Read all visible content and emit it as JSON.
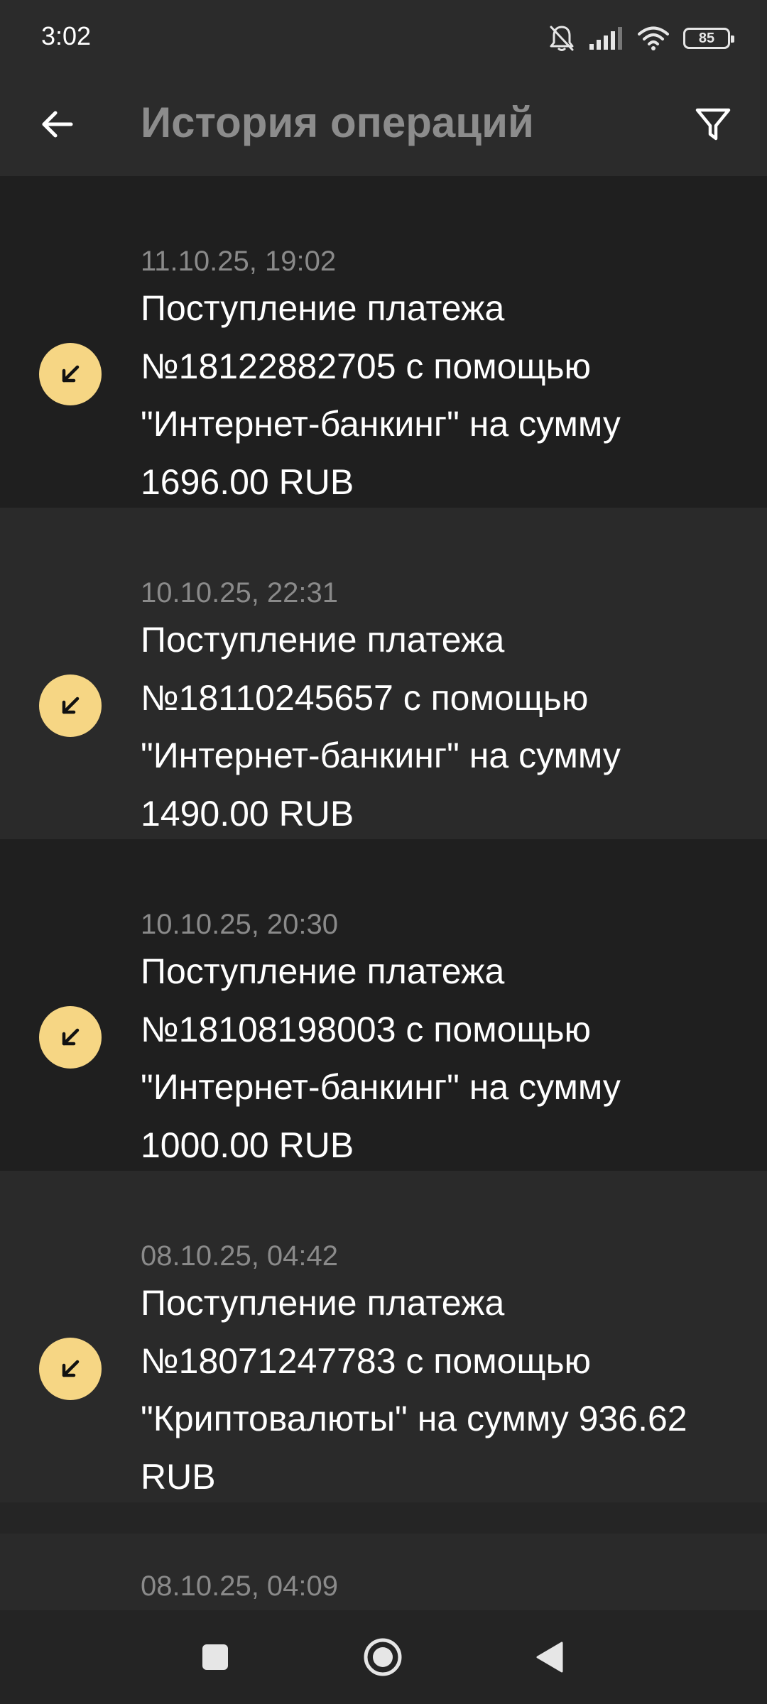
{
  "status_bar": {
    "time": "3:02",
    "battery": "85",
    "icons": [
      "bell-off-icon",
      "signal-icon",
      "wifi-icon",
      "battery-icon"
    ]
  },
  "header": {
    "title": "История операций",
    "back_icon": "arrow-left-icon",
    "filter_icon": "filter-icon"
  },
  "operations": [
    {
      "date": "11.10.25, 19:02",
      "description": "Поступление платежа №18122882705 с помощью \"Интернет-банкинг\" на сумму 1696.00 RUB",
      "icon": "incoming-arrow-icon"
    },
    {
      "date": "10.10.25, 22:31",
      "description": "Поступление платежа №18110245657 с помощью \"Интернет-банкинг\" на сумму 1490.00 RUB",
      "icon": "incoming-arrow-icon"
    },
    {
      "date": "10.10.25, 20:30",
      "description": "Поступление платежа №18108198003 с помощью \"Интернет-банкинг\" на сумму 1000.00 RUB",
      "icon": "incoming-arrow-icon"
    },
    {
      "date": "08.10.25, 04:42",
      "description": "Поступление платежа №18071247783 с помощью \"Криптовалюты\" на сумму 936.62 RUB",
      "icon": "incoming-arrow-icon"
    },
    {
      "date": "08.10.25, 04:09"
    }
  ],
  "colors": {
    "accent": "#f6d684",
    "background": "#252525"
  }
}
